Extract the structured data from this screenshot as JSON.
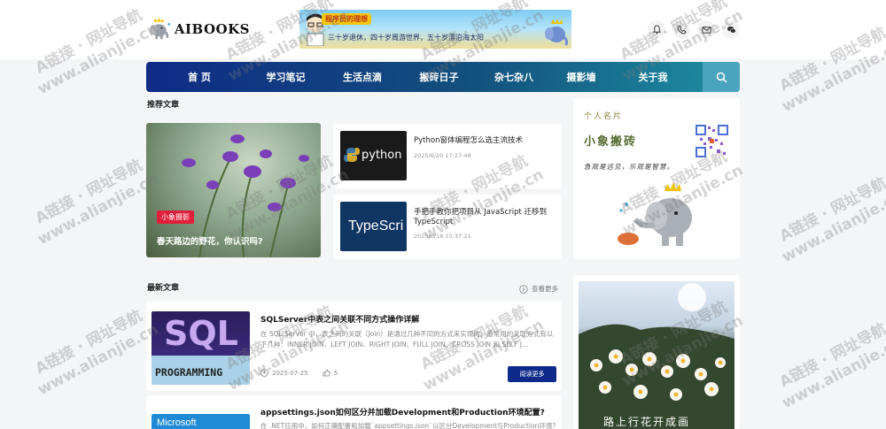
{
  "header": {
    "logo_text": "AIBOOKS",
    "banner": {
      "badge": "程序员的理想",
      "text": "三十岁退休，四十岁周游世界，五十岁漂泊海太阳"
    },
    "icons": [
      "bell-icon",
      "phone-icon",
      "mail-icon",
      "wechat-icon"
    ]
  },
  "nav": {
    "items": [
      {
        "label": "首 页"
      },
      {
        "label": "学习笔记"
      },
      {
        "label": "生活点滴"
      },
      {
        "label": "搬砖日子"
      },
      {
        "label": "杂七杂八"
      },
      {
        "label": "摄影墙"
      },
      {
        "label": "关于我"
      }
    ],
    "search_icon": "search-icon"
  },
  "recommended": {
    "heading": "推荐文章",
    "featured": {
      "tag": "小象摄影",
      "title": "春天路边的野花，你认识吗?"
    },
    "items": [
      {
        "title": "Python窗体编程怎么选主流技术",
        "date": "2025/6/20 17:27:48",
        "thumb_text": "python"
      },
      {
        "title": "手把手教你把项目从 JavaScript 迁移到 TypeScript",
        "date": "2025/6/16 15:37:21",
        "thumb_text": "TypeScri"
      }
    ]
  },
  "profile_card": {
    "label": "个人名片",
    "name": "小象搬砖",
    "motto": "急观是远见，乐观是智慧。"
  },
  "latest": {
    "heading": "最新文章",
    "more_label": "查看更多",
    "posts": [
      {
        "title": "SQLServer中表之间关联不同方式操作详解",
        "excerpt": "在 SQL Server 中，表之间的关联（Join）是通过几种不同的方式来实现的。最常用的关联方式有以下几种：INNER JOIN、LEFT JOIN、RIGHT JOIN、FULL JOIN、CROSS JOIN 和 SELF J...",
        "date": "2025-07-25",
        "likes": "5",
        "button": "阅读更多",
        "thumb_line1": "SQL",
        "thumb_line2": "PROGRAMMING"
      },
      {
        "title": "appsettings.json如何区分并加载Development和Production环境配置?",
        "excerpt": "在 .NET应用中，如何正确配置和加载`appsettings.json`以区分Development与Production环境?",
        "thumb_line1": "Microsoft"
      }
    ]
  },
  "side_photo": {
    "caption": "路上行花开成画"
  },
  "watermark": {
    "line1": "A链接 · 网址导航",
    "line2": "www.alianjie.cn"
  },
  "colors": {
    "nav_start": "#0f2b86",
    "nav_end": "#1e8fa3",
    "tag_red": "#e0203a",
    "button_blue": "#0d2a8a"
  }
}
